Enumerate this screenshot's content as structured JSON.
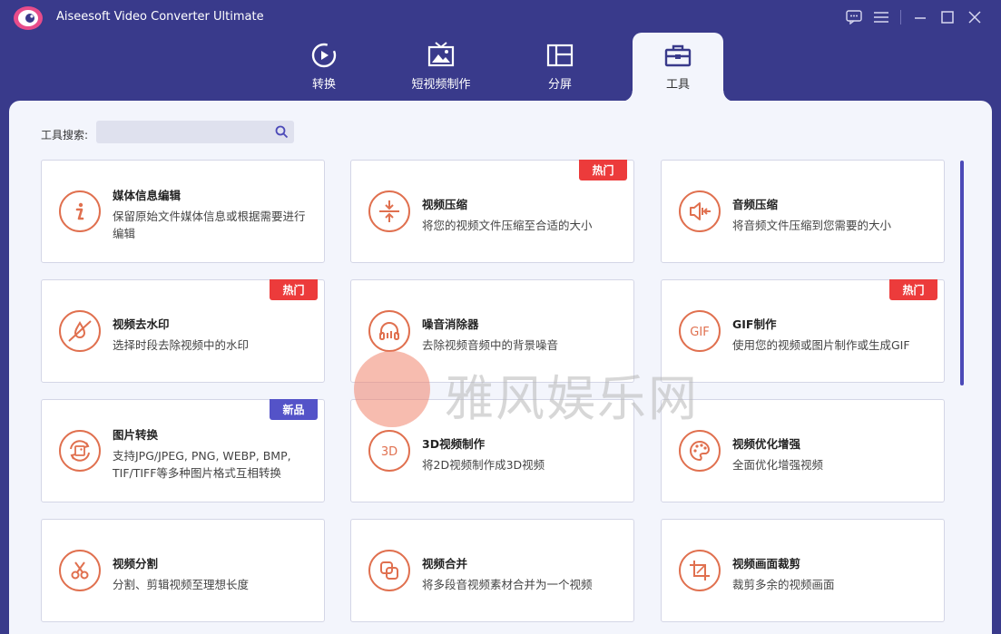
{
  "app": {
    "title": "Aiseesoft Video Converter Ultimate"
  },
  "tabs": [
    {
      "label": "转换",
      "icon": "convert-icon"
    },
    {
      "label": "短视频制作",
      "icon": "mv-icon"
    },
    {
      "label": "分屏",
      "icon": "collage-icon"
    },
    {
      "label": "工具",
      "icon": "toolbox-icon",
      "active": true
    }
  ],
  "search": {
    "label": "工具搜索:",
    "value": "",
    "placeholder": ""
  },
  "tools": [
    {
      "title": "媒体信息编辑",
      "desc": "保留原始文件媒体信息或根据需要进行编辑",
      "icon": "info-icon",
      "badge": ""
    },
    {
      "title": "视频压缩",
      "desc": "将您的视频文件压缩至合适的大小",
      "icon": "compress-icon",
      "badge": "热门"
    },
    {
      "title": "音频压缩",
      "desc": "将音频文件压缩到您需要的大小",
      "icon": "audio-compress-icon",
      "badge": ""
    },
    {
      "title": "视频去水印",
      "desc": "选择时段去除视频中的水印",
      "icon": "watermark-remove-icon",
      "badge": "热门"
    },
    {
      "title": "噪音消除器",
      "desc": "去除视频音频中的背景噪音",
      "icon": "headphones-icon",
      "badge": ""
    },
    {
      "title": "GIF制作",
      "desc": "使用您的视频或图片制作或生成GIF",
      "icon": "gif-icon",
      "badge": "热门"
    },
    {
      "title": "图片转换",
      "desc": "支持JPG/JPEG, PNG, WEBP, BMP, TIF/TIFF等多种图片格式互相转换",
      "icon": "image-convert-icon",
      "badge": "新品"
    },
    {
      "title": "3D视频制作",
      "desc": "将2D视频制作成3D视频",
      "icon": "3d-icon",
      "badge": ""
    },
    {
      "title": "视频优化增强",
      "desc": "全面优化增强视频",
      "icon": "palette-icon",
      "badge": ""
    },
    {
      "title": "视频分割",
      "desc": "分割、剪辑视频至理想长度",
      "icon": "scissors-icon",
      "badge": ""
    },
    {
      "title": "视频合并",
      "desc": "将多段音视频素材合并为一个视频",
      "icon": "merge-icon",
      "badge": ""
    },
    {
      "title": "视频画面裁剪",
      "desc": "裁剪多余的视频画面",
      "icon": "crop-icon",
      "badge": ""
    }
  ],
  "watermark": {
    "text": "雅风娱乐网"
  },
  "colors": {
    "brand": "#393a8b",
    "accent": "#e0704f",
    "hot": "#ec3b3b",
    "new": "#5453c8",
    "content_bg": "#f3f5fc"
  }
}
